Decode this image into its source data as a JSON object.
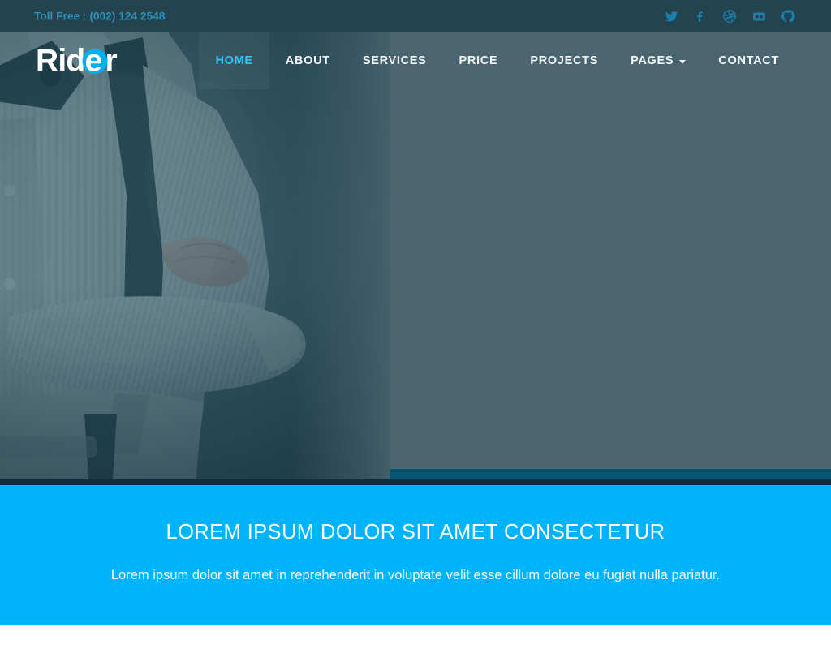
{
  "topbar": {
    "toll_free": "Toll Free : (002) 124 2548",
    "social": [
      {
        "name": "twitter-icon",
        "label": "Twitter"
      },
      {
        "name": "facebook-icon",
        "label": "Facebook"
      },
      {
        "name": "dribbble-icon",
        "label": "Dribbble"
      },
      {
        "name": "flickr-icon",
        "label": "Flickr"
      },
      {
        "name": "github-icon",
        "label": "GitHub"
      }
    ]
  },
  "brand": {
    "text_before": "Rid",
    "accent_letter": "e",
    "text_after": "r",
    "full": "Rider",
    "accent_color": "#00b0f0"
  },
  "nav": {
    "items": [
      {
        "label": "HOME",
        "active": true,
        "dropdown": false
      },
      {
        "label": "ABOUT",
        "active": false,
        "dropdown": false
      },
      {
        "label": "SERVICES",
        "active": false,
        "dropdown": false
      },
      {
        "label": "PRICE",
        "active": false,
        "dropdown": false
      },
      {
        "label": "PROJECTS",
        "active": false,
        "dropdown": false
      },
      {
        "label": "PAGES",
        "active": false,
        "dropdown": true
      },
      {
        "label": "CONTACT",
        "active": false,
        "dropdown": false
      }
    ]
  },
  "hero": {
    "image_description": "Man in white tuxedo shirt with black bow tie and suspenders, arms crossed, teal color overlay"
  },
  "cta": {
    "title": "LOREM IPSUM DOLOR SIT AMET CONSECTETUR",
    "subtitle": "Lorem ipsum dolor sit amet in reprehenderit in voluptate velit esse cillum dolore eu fugiat nulla pariatur.",
    "background_color": "#00b4fc"
  },
  "colors": {
    "topbar": "#23444f",
    "hero_panel": "#4a6570",
    "accent_blue": "#00b4fc",
    "nav_active": "#33c3f5",
    "strip_teal": "#075370",
    "strip_dark": "#0b2f3e"
  }
}
